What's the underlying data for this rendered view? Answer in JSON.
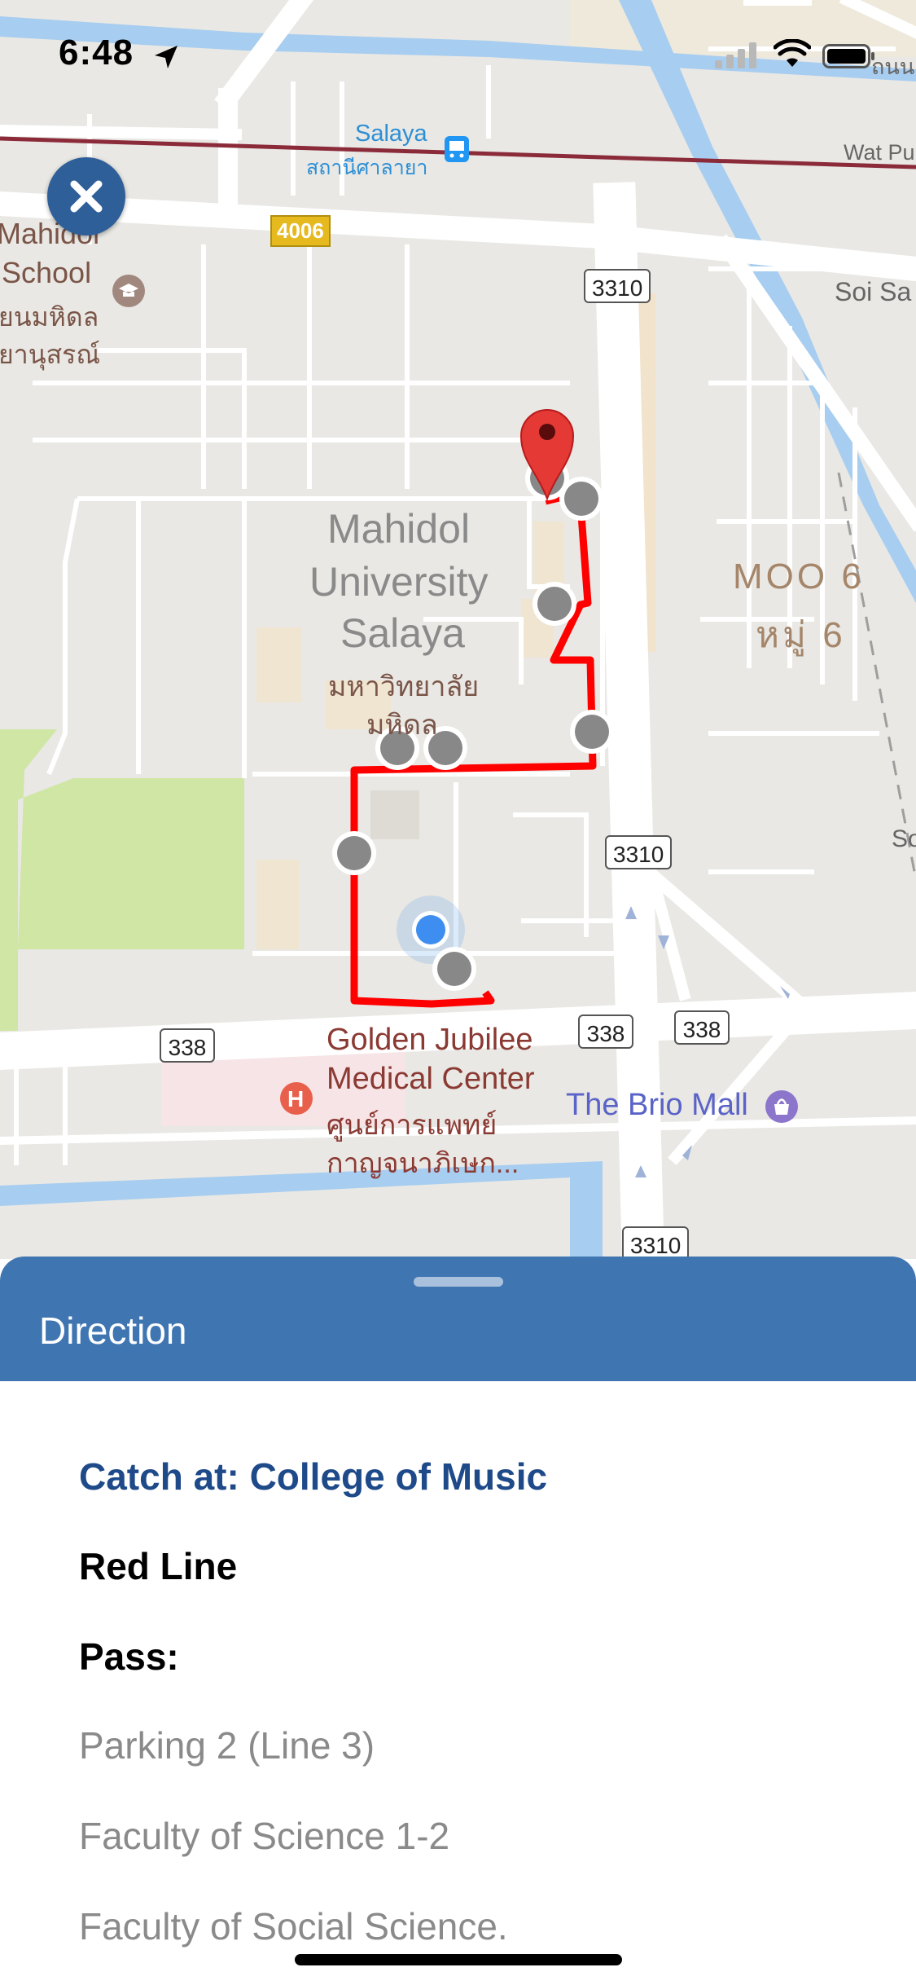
{
  "status_bar": {
    "time": "6:48"
  },
  "map": {
    "labels": {
      "salaya_en": "Salaya",
      "salaya_th": "สถานีศาลายา",
      "wat_pu": "Wat Pu",
      "thai_top_right": "ถนน",
      "hwy_4006": "4006",
      "school_line1": "Mahidol",
      "school_line2": "School",
      "school_line3": "ยนมหิดล",
      "school_line4": "ยานุสรณ์",
      "soi_sa": "Soi Sa",
      "univ_line1": "Mahidol",
      "univ_line2": "University",
      "univ_line3": "Salaya",
      "univ_th1": "มหาวิทยาลัย",
      "univ_th2": "มหิดล",
      "moo6_en": "MOO 6",
      "moo6_th": "หมู่ 6",
      "so": "So",
      "hosp_line1": "Golden Jubilee",
      "hosp_line2": "Medical Center",
      "hosp_th1": "ศูนย์การแพทย์",
      "hosp_th2": "กาญจนาภิเษก...",
      "mall": "The Brio Mall",
      "hospital_glyph": "H"
    },
    "route_badges": {
      "r3310a": "3310",
      "r3310b": "3310",
      "r3310c": "3310",
      "r338a": "338",
      "r338b": "338",
      "r338c": "338"
    },
    "route_color": "#ff0000",
    "stop_color": "#888888",
    "user_location_color": "#3d8ef0",
    "pin_color": "#e53935"
  },
  "close_button": {
    "icon": "close-icon"
  },
  "sheet": {
    "title": "Direction",
    "catch_at": "Catch at: College of Music",
    "line_name": "Red Line",
    "pass_label": "Pass:",
    "stops": [
      "Parking 2 (Line 3)",
      "Faculty of Science 1-2",
      "Faculty of Social Science."
    ]
  }
}
